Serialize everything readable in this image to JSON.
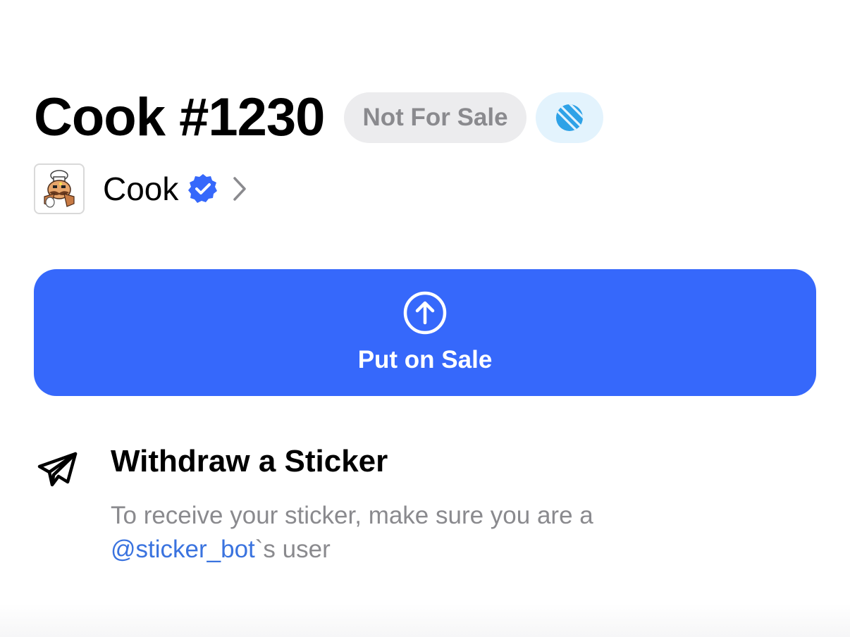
{
  "header": {
    "title": "Cook #1230",
    "status_badge": "Not For Sale",
    "currency_icon": "ton-icon"
  },
  "collection": {
    "name": "Cook",
    "verified_icon": "verified-badge-icon",
    "chevron_icon": "chevron-right-icon"
  },
  "sale_button": {
    "label": "Put on Sale",
    "icon": "arrow-up-circle-icon",
    "color": "#3668fb"
  },
  "withdraw": {
    "icon": "paper-plane-icon",
    "title": "Withdraw a Sticker",
    "description_prefix": "To receive your sticker, make sure you are a",
    "bot_link": "@sticker_bot",
    "description_suffix": "`s user"
  },
  "colors": {
    "accent": "#3668fb",
    "link": "#3a73df",
    "muted_text": "#8a8a8e",
    "badge_bg": "#ececee",
    "ton_badge_bg": "#e3f3fd",
    "ton_icon": "#2ea2e7"
  }
}
